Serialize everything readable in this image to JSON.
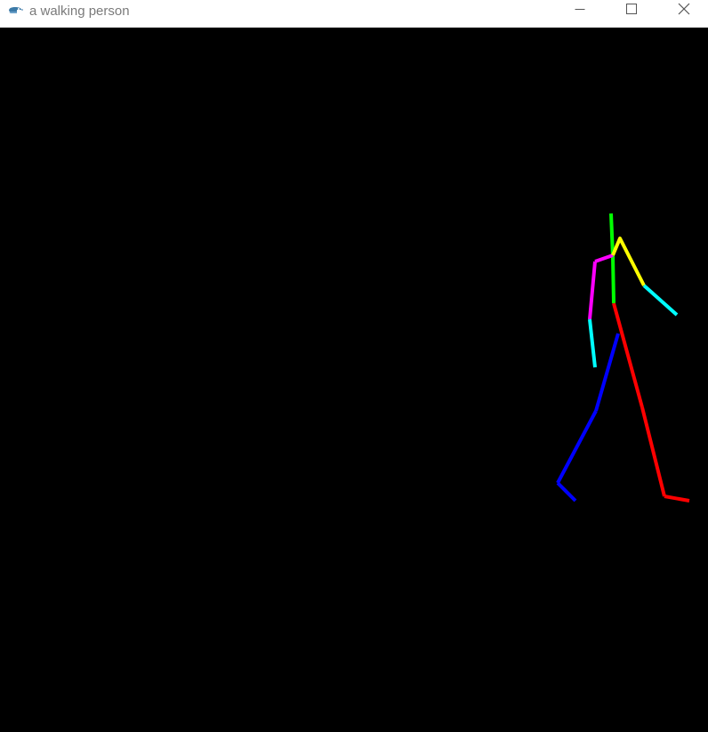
{
  "window": {
    "title": "a walking person",
    "icon": "python-snake-icon"
  },
  "controls": {
    "minimize_icon": "minimize-icon",
    "maximize_icon": "maximize-icon",
    "close_icon": "close-icon"
  },
  "figure": {
    "background": "#000000",
    "segments": [
      {
        "name": "head-neck-segment",
        "color": "#00ff00"
      },
      {
        "name": "torso-segment",
        "color": "#00ff00"
      },
      {
        "name": "left-shoulder-segment",
        "color": "#ff00ff"
      },
      {
        "name": "left-upper-arm-segment",
        "color": "#ff00ff"
      },
      {
        "name": "left-forearm-segment",
        "color": "#00ffff"
      },
      {
        "name": "right-upper-arm-segment",
        "color": "#ffff00"
      },
      {
        "name": "right-forearm-segment",
        "color": "#00ffff"
      },
      {
        "name": "right-thigh-segment",
        "color": "#ff0000"
      },
      {
        "name": "right-shin-segment",
        "color": "#ff0000"
      },
      {
        "name": "right-foot-segment",
        "color": "#ff0000"
      },
      {
        "name": "left-thigh-segment",
        "color": "#0000ff"
      },
      {
        "name": "left-shin-segment",
        "color": "#0000ff"
      },
      {
        "name": "left-foot-segment",
        "color": "#0000ff"
      }
    ]
  }
}
